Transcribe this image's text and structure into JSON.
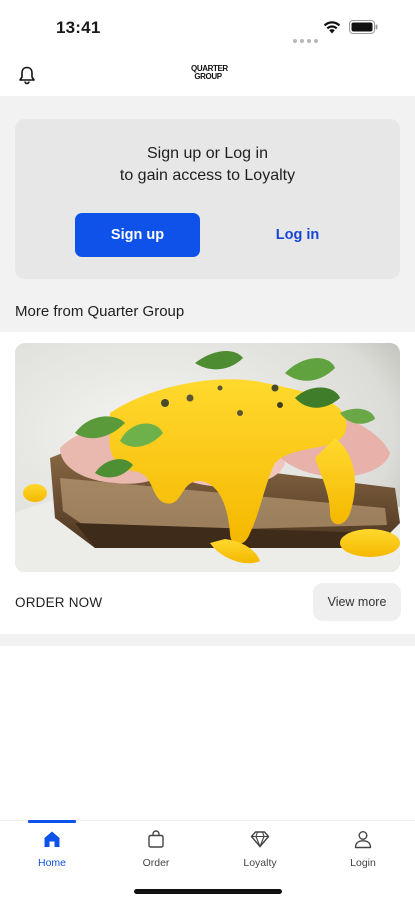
{
  "status_bar": {
    "time": "13:41",
    "icons": [
      "signal-dots-icon",
      "wifi-icon",
      "battery-icon"
    ]
  },
  "header": {
    "logo_line1": "QUARTER",
    "logo_line2": "GROUP",
    "left_icon": "bell-icon"
  },
  "loyalty": {
    "line1": "Sign up or Log in",
    "line2": "to gain access to Loyalty",
    "signup_label": "Sign up",
    "login_label": "Log in"
  },
  "section": {
    "title": "More from Quarter Group"
  },
  "promo": {
    "image": "eggs-benedict-photo",
    "cta_label": "ORDER NOW",
    "view_more_label": "View more"
  },
  "tabs": [
    {
      "label": "Home",
      "icon": "home-icon",
      "active": true
    },
    {
      "label": "Order",
      "icon": "shopping-bag-icon",
      "active": false
    },
    {
      "label": "Loyalty",
      "icon": "diamond-icon",
      "active": false
    },
    {
      "label": "Login",
      "icon": "user-icon",
      "active": false
    }
  ],
  "colors": {
    "accent": "#0e52e9",
    "background": "#f2f2f2",
    "card": "#e7e7e7"
  }
}
